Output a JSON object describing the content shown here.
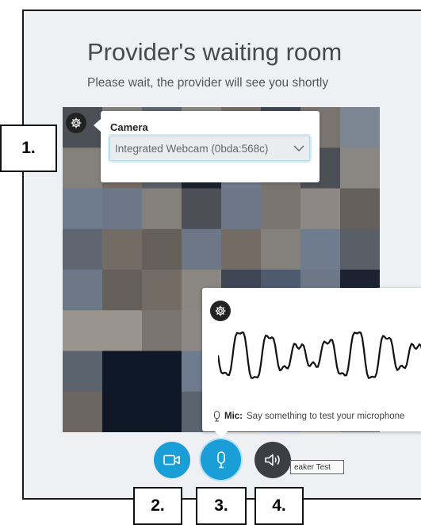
{
  "waiting_room": {
    "title": "Provider's waiting room",
    "subtitle": "Please wait, the provider will see you shortly"
  },
  "camera_popup": {
    "label": "Camera",
    "selected_device": "Integrated Webcam (0bda:568c)",
    "icon": "gear-icon"
  },
  "mic_popup": {
    "label": "Mic:",
    "message": "Say something to test your microphone",
    "icon": "gear-icon"
  },
  "controls": {
    "video_icon": "video-camera-icon",
    "mic_icon": "microphone-icon",
    "speaker_icon": "speaker-icon",
    "tooltip": "eaker Test"
  },
  "callouts": [
    "1.",
    "2.",
    "3.",
    "4."
  ],
  "colors": {
    "accent": "#1a9ed8",
    "dark_button": "#3b3f44",
    "background": "#eef0f3"
  }
}
